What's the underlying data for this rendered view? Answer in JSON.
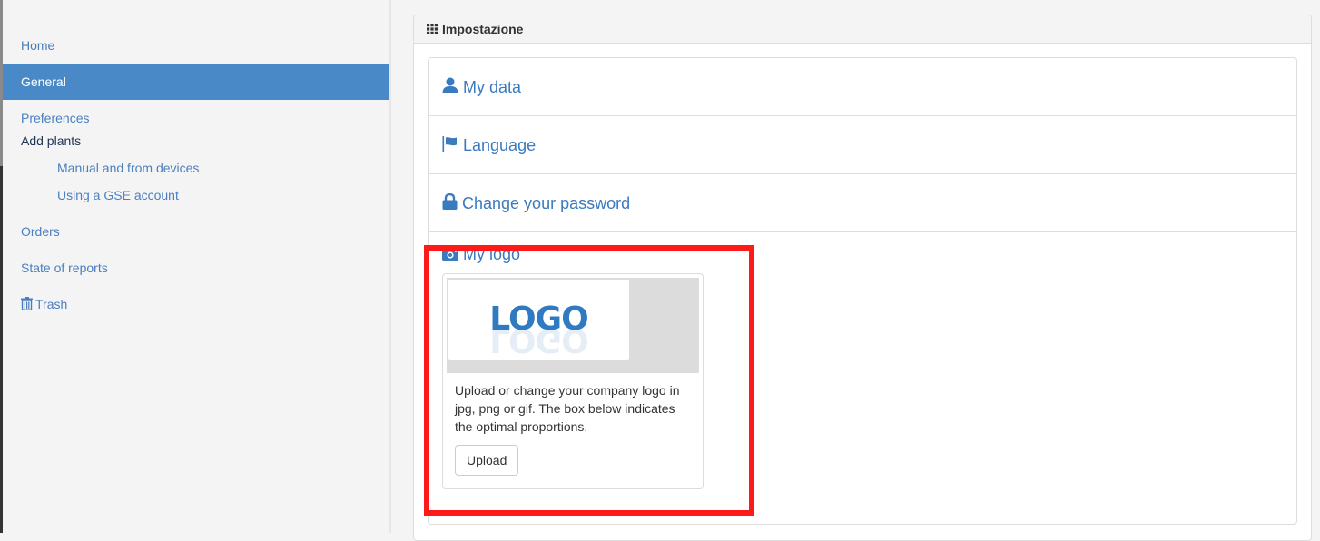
{
  "sidebar": {
    "items": [
      {
        "label": "Home",
        "active": false
      },
      {
        "label": "General",
        "active": true
      },
      {
        "label": "Preferences",
        "active": false
      },
      {
        "label": "Add plants",
        "active": false
      },
      {
        "label": "Manual and from devices",
        "active": false
      },
      {
        "label": "Using a GSE account",
        "active": false
      },
      {
        "label": "Orders",
        "active": false
      },
      {
        "label": "State of reports",
        "active": false
      },
      {
        "label": "Trash",
        "icon": "trash-icon",
        "active": false
      }
    ]
  },
  "panel": {
    "title": "Impostazione",
    "title_icon": "grid-icon",
    "sections": [
      {
        "label": "My data",
        "icon": "user-icon"
      },
      {
        "label": "Language",
        "icon": "flag-icon"
      },
      {
        "label": "Change your password",
        "icon": "lock-icon"
      },
      {
        "label": "My logo",
        "icon": "camera-icon"
      }
    ],
    "logo": {
      "placeholder_text": "LOGO",
      "caption": "Upload or change your company logo in jpg, png or gif. The box below indicates the optimal proportions.",
      "upload_label": "Upload"
    }
  },
  "colors": {
    "accent": "#4a89c8",
    "link": "#3a7abf",
    "highlight": "#ff1a1a"
  }
}
